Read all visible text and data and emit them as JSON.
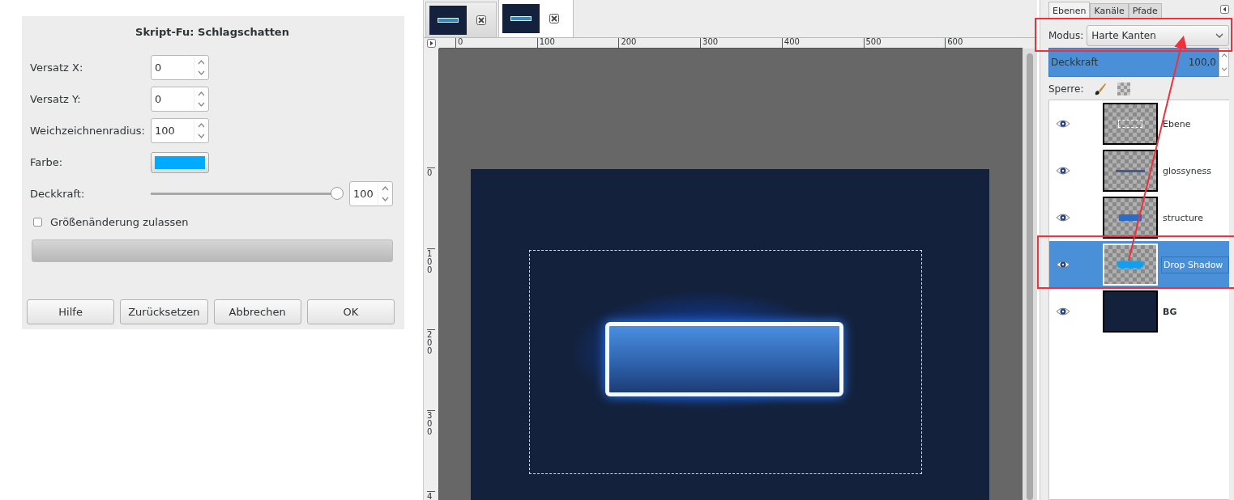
{
  "dialog": {
    "title": "Skript-Fu: Schlagschatten",
    "fields": [
      {
        "kind": "spin",
        "label": "Versatz X:",
        "value": "0"
      },
      {
        "kind": "spin",
        "label": "Versatz Y:",
        "value": "0"
      },
      {
        "kind": "spin",
        "label": "Weichzeichnenradius:",
        "value": "100"
      },
      {
        "kind": "color",
        "label": "Farbe:",
        "color": "#00aaff"
      },
      {
        "kind": "slider",
        "label": "Deckkraft:",
        "level": 1,
        "value": "100"
      }
    ],
    "checkbox": {
      "label": "Größenänderung zulassen",
      "checked": false
    },
    "progress": {
      "level": 0
    },
    "buttons": [
      "Hilfe",
      "Zurücksetzen",
      "Abbrechen",
      "OK"
    ]
  },
  "image_tabs": [
    {
      "selected": false
    },
    {
      "selected": true
    }
  ],
  "ruler": {
    "h_ticks": [
      "0",
      "100",
      "200",
      "300",
      "400",
      "500",
      "600"
    ],
    "v_ticks": [
      "0",
      "100",
      "200",
      "300",
      "4"
    ]
  },
  "layers_panel": {
    "tabs": [
      {
        "label": "Ebenen",
        "selected": true
      },
      {
        "label": "Kanäle",
        "selected": false
      },
      {
        "label": "Pfade",
        "selected": false
      }
    ],
    "mode_label": "Modus:",
    "mode_value": "Harte Kanten",
    "opacity": {
      "label": "Deckkraft",
      "value": "100,0",
      "level": 1
    },
    "lock_label": "Sperre:",
    "layers": [
      {
        "name": "Ebene",
        "kind": "frame",
        "visible": true,
        "selected": false,
        "bold": false
      },
      {
        "name": "glossyness",
        "kind": "line",
        "visible": true,
        "selected": false,
        "bold": false
      },
      {
        "name": "structure",
        "kind": "bar",
        "visible": true,
        "selected": false,
        "bold": false
      },
      {
        "name": "Drop Shadow",
        "kind": "glow",
        "visible": true,
        "selected": true,
        "bold": false
      },
      {
        "name": "BG",
        "kind": "fill",
        "visible": true,
        "selected": false,
        "bold": true
      }
    ]
  }
}
